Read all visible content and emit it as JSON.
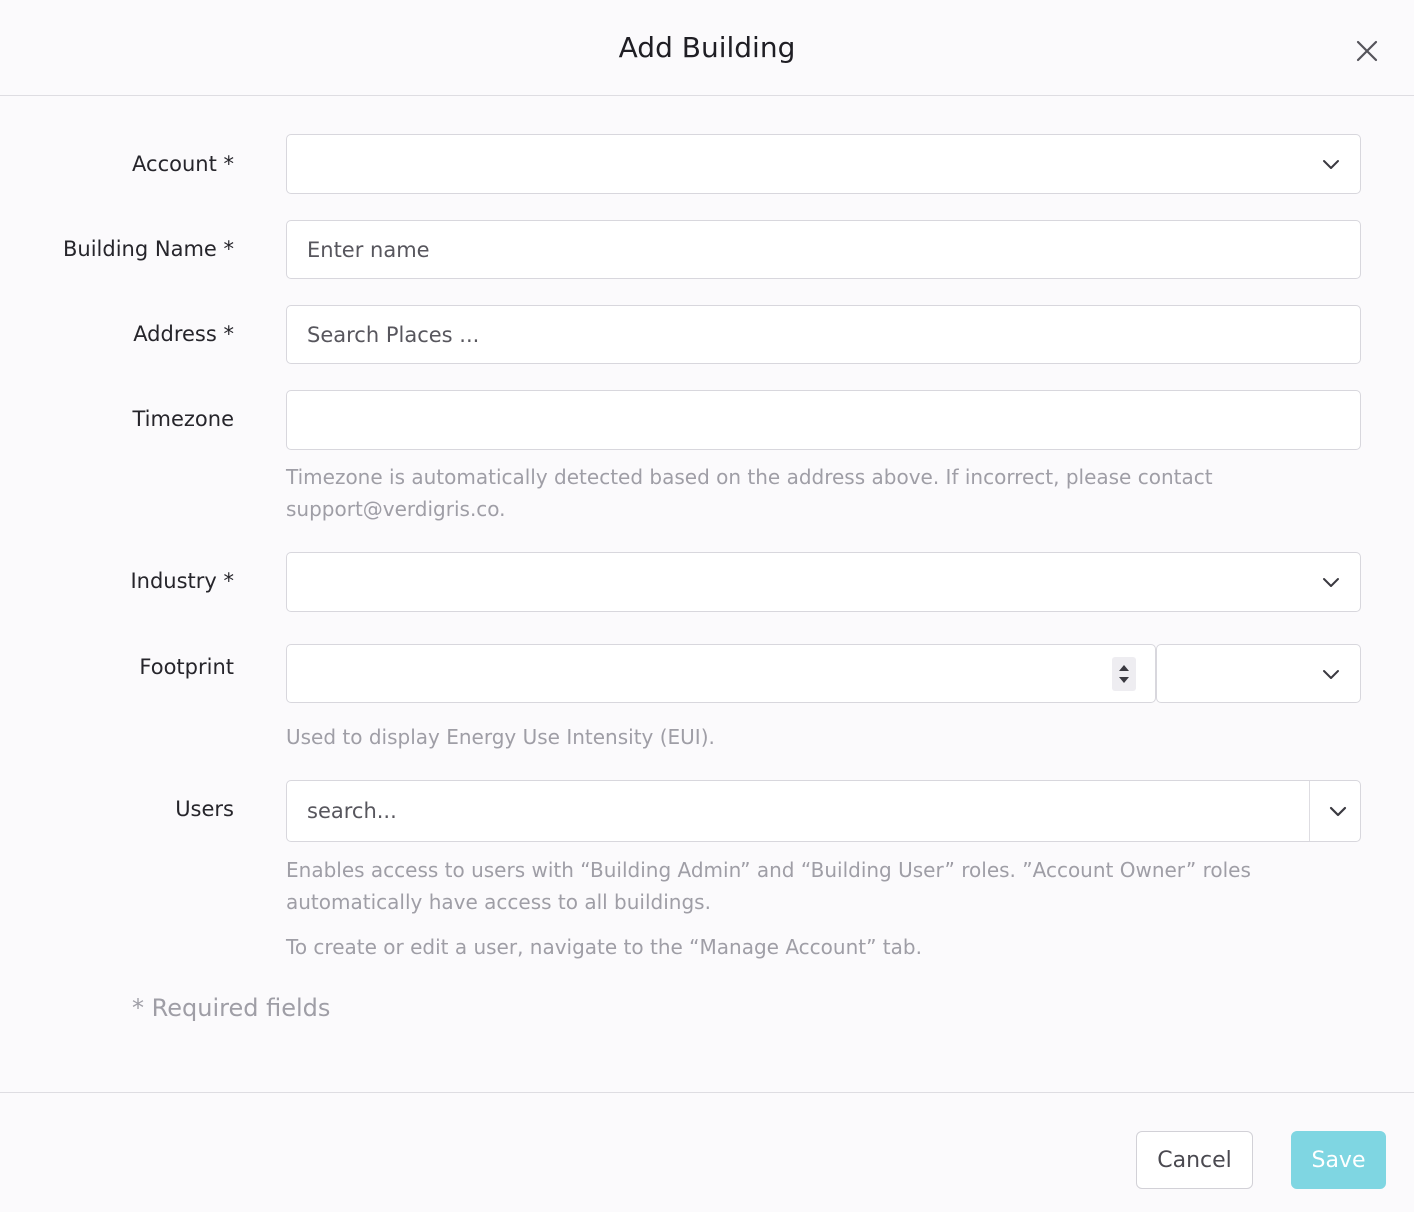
{
  "dialog": {
    "title": "Add Building",
    "close_icon": "close-icon"
  },
  "form": {
    "account": {
      "label": "Account *",
      "value": ""
    },
    "building_name": {
      "label": "Building Name *",
      "placeholder": "Enter name",
      "value": ""
    },
    "address": {
      "label": "Address *",
      "placeholder": "Search Places ...",
      "value": ""
    },
    "timezone": {
      "label": "Timezone",
      "value": "",
      "help": "Timezone is automatically detected based on the address above. If incorrect, please contact support@verdigris.co."
    },
    "industry": {
      "label": "Industry *",
      "value": ""
    },
    "footprint": {
      "label": "Footprint",
      "value": "",
      "unit_value": "",
      "help": "Used to display Energy Use Intensity (EUI)."
    },
    "users": {
      "label": "Users",
      "placeholder": "search...",
      "help1": "Enables access to users with “Building Admin” and “Building User” roles. ”Account Owner” roles automatically have access to all buildings.",
      "help2": "To create or edit a user, navigate to the “Manage Account” tab."
    },
    "required_note": "* Required fields"
  },
  "footer": {
    "cancel_label": "Cancel",
    "save_label": "Save"
  },
  "colors": {
    "save_bg": "#7fd6e2",
    "help_text": "#9f9ea6",
    "border": "#d8d7dd"
  }
}
